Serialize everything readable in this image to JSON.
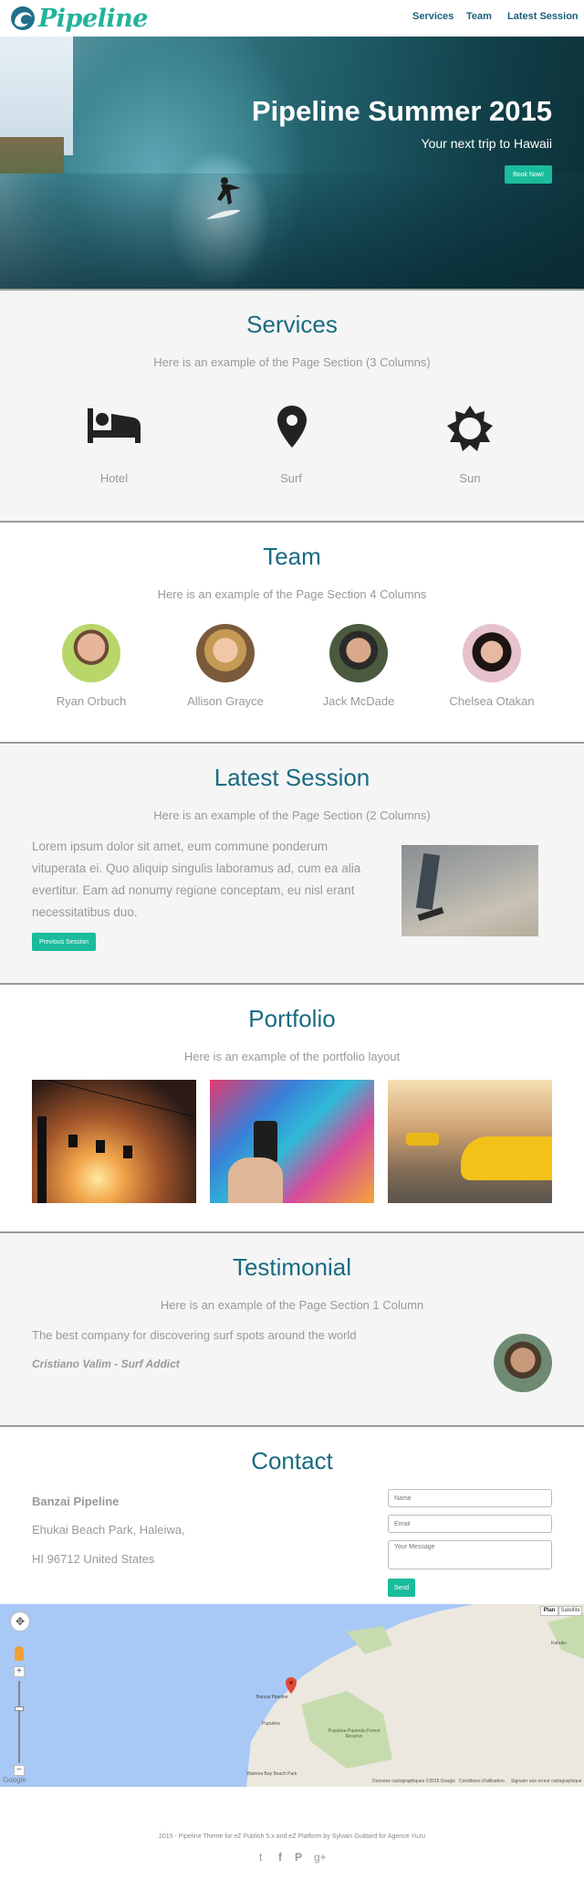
{
  "header": {
    "logo_text": "Pipeline",
    "nav": [
      {
        "label": "Services"
      },
      {
        "label": "Team"
      },
      {
        "label": "Latest Session"
      }
    ]
  },
  "hero": {
    "title": "Pipeline Summer 2015",
    "subtitle": "Your next trip to Hawaii",
    "button": "Book Now!"
  },
  "services": {
    "title": "Services",
    "lead": "Here is an example of the Page Section (3 Columns)",
    "items": [
      {
        "label": "Hotel",
        "icon": "bed-icon"
      },
      {
        "label": "Surf",
        "icon": "map-pin-icon"
      },
      {
        "label": "Sun",
        "icon": "sun-icon"
      }
    ]
  },
  "team": {
    "title": "Team",
    "lead": "Here is an example of the Page Section 4 Columns",
    "members": [
      {
        "name": "Ryan Orbuch"
      },
      {
        "name": "Allison Grayce"
      },
      {
        "name": "Jack McDade"
      },
      {
        "name": "Chelsea Otakan"
      }
    ]
  },
  "latest": {
    "title": "Latest Session",
    "lead": "Here is an example of the Page Section (2 Columns)",
    "lines": [
      "Lorem ipsum dolor sit amet, eum commune ponderum",
      "vituperata ei. Quo aliquip singulis laboramus ad, cum ea alia",
      "evertitur. Eam ad nonumy regione conceptam, eu nisl erant",
      "necessitatibus duo."
    ],
    "button": "Previous Session"
  },
  "portfolio": {
    "title": "Portfolio",
    "lead": "Here is an example of the portfolio layout"
  },
  "testimonial": {
    "title": "Testimonial",
    "lead": "Here is an example of the Page Section 1 Column",
    "quote": "The best company for discovering surf spots around the world",
    "author": "Cristiano Valim - Surf Addict"
  },
  "contact": {
    "title": "Contact",
    "name": "Banzai Pipeline",
    "address1": "Ehukai Beach Park, Haleiwa,",
    "address2": "HI 96712 United States",
    "name_placeholder": "Name",
    "email_placeholder": "Email",
    "message_placeholder": "Your Message",
    "send": "Send"
  },
  "map": {
    "plan": "Plan",
    "satellite": "Satellite",
    "marker_label": "Banzai Pipeline",
    "places": [
      "Pupukea",
      "Pupukea-Paumalu Forest Reserve",
      "Waimea Bay Beach Park",
      "Kahuku"
    ],
    "google": "Google",
    "attribution": "Données cartographiques ©2015 Google",
    "terms": "Conditions d'utilisation",
    "report": "Signaler une erreur cartographique"
  },
  "footer": {
    "text": "2015 - Pipeline Theme for eZ Publish 5.x and eZ Platform by Sylvain Guittard for Agence Yuzu",
    "social": [
      {
        "glyph": "t",
        "icon": "twitter-icon"
      },
      {
        "glyph": "f",
        "icon": "facebook-icon"
      },
      {
        "glyph": "P",
        "icon": "pinterest-icon"
      },
      {
        "glyph": "g+",
        "icon": "google-plus-icon"
      }
    ]
  },
  "colors": {
    "accent": "#1abc9c",
    "heading": "#1a6b82",
    "text": "#999999"
  }
}
